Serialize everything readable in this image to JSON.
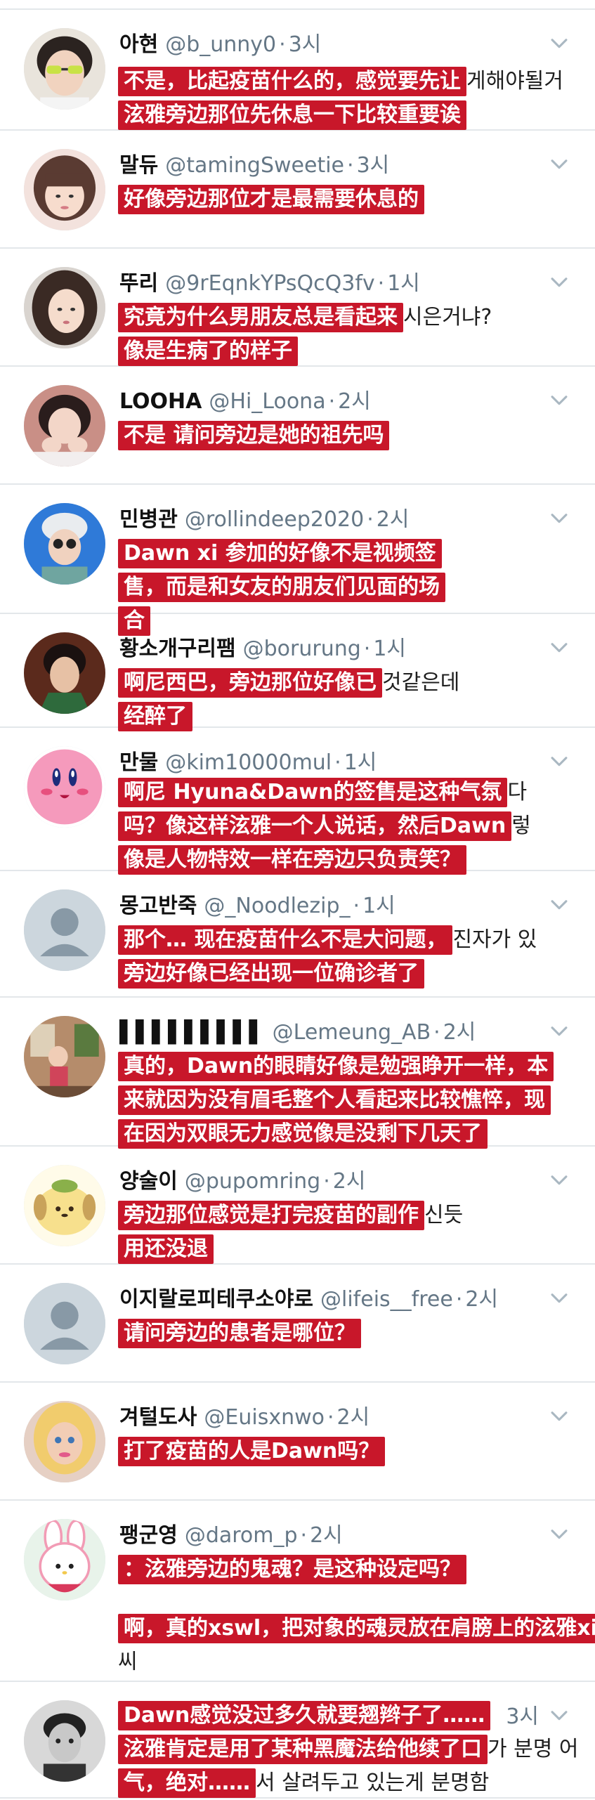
{
  "colors": {
    "overlay_red": "#c8172a",
    "divider": "#e3e7ea",
    "meta_gray": "#657786",
    "chevron_gray": "#aab8c2"
  },
  "tweets": [
    {
      "name": "아현",
      "handle": "@b_unny0",
      "time": "3시",
      "avatar": "girl-sunglasses",
      "lines": [
        {
          "hl": "不是，比起疫苗什么的，感觉要先让",
          "rest": "게해야될거"
        },
        {
          "hl": "泫雅旁边那位先休息一下比较重要诶",
          "rest": ""
        }
      ]
    },
    {
      "name": "말듀",
      "handle": "@tamingSweetie",
      "time": "3시",
      "avatar": "girl-bangs",
      "lines": [
        {
          "hl": "好像旁边那位才是最需要休息的",
          "rest": ""
        }
      ]
    },
    {
      "name": "뚜리",
      "handle": "@9rEqnkYPsQcQ3fv",
      "time": "1시",
      "avatar": "girl-long-hair",
      "lines": [
        {
          "hl": "究竟为什么男朋友总是看起来",
          "rest": "시은거냐?"
        },
        {
          "hl": "像是生病了的样子",
          "rest": ""
        }
      ]
    },
    {
      "name": "LOOHA",
      "handle": "@Hi_Loona",
      "time": "2시",
      "avatar": "girl-hands",
      "lines": [
        {
          "hl": "不是 请问旁边是她的祖先吗",
          "rest": ""
        }
      ]
    },
    {
      "name": "민병관",
      "handle": "@rollindeep2020",
      "time": "2시",
      "avatar": "person-hat",
      "lines": [
        {
          "hl": "Dawn xi 参加的好像不是视频签",
          "rest": ""
        },
        {
          "hl": "售，而是和女友的朋友们见面的场",
          "rest": ""
        },
        {
          "hl": "合",
          "rest": ""
        }
      ]
    },
    {
      "name": "황소개구리팸",
      "handle": "@borurung",
      "time": "1시",
      "avatar": "woman-traditional",
      "lines": [
        {
          "hl": "啊尼西巴，旁边那位好像已",
          "rest": "것같은데"
        },
        {
          "hl": "经醉了",
          "rest": ""
        }
      ]
    },
    {
      "name": "만물",
      "handle": "@kim10000mul",
      "time": "1시",
      "avatar": "kirby",
      "lines": [
        {
          "hl": "啊尼 Hyuna&Dawn的签售是这种气氛",
          "rest": "다"
        },
        {
          "hl": "吗？像这样泫雅一个人说话，然后Dawn",
          "rest": "렇"
        },
        {
          "hl": "像是人物特效一样在旁边只负责笑？",
          "rest": ""
        }
      ]
    },
    {
      "name": "몽고반죽",
      "handle": "@_Noodlezip_",
      "time": "1시",
      "avatar": "default",
      "lines": [
        {
          "hl": "那个… 现在疫苗什么不是大问题，",
          "rest": "진자가 있"
        },
        {
          "hl": "旁边好像已经出现一位确诊者了",
          "rest": ""
        }
      ]
    },
    {
      "name": "▌▌▌▌▌▌▌▌▌",
      "handle": "@Lemeung_AB",
      "time": "2시",
      "avatar": "child-room",
      "lines": [
        {
          "hl": "真的，Dawn的眼睛好像是勉强睁开一样，本",
          "rest": ""
        },
        {
          "hl": "来就因为没有眉毛整个人看起来比较憔悴，现",
          "rest": ""
        },
        {
          "hl": "在因为双眼无力感觉像是没剩下几天了",
          "rest": ""
        }
      ]
    },
    {
      "name": "양술이",
      "handle": "@pupomring",
      "time": "2시",
      "avatar": "pompompurin",
      "lines": [
        {
          "hl": "旁边那位感觉是打完疫苗的副作",
          "rest": "신듯"
        },
        {
          "hl": "用还没退",
          "rest": ""
        }
      ]
    },
    {
      "name": "이지랄로피테쿠소야로",
      "handle": "@lifeis__free",
      "time": "2시",
      "avatar": "default",
      "lines": [
        {
          "hl": "请问旁边的患者是哪位？",
          "rest": ""
        }
      ]
    },
    {
      "name": "겨털도사",
      "handle": "@Euisxnwo",
      "time": "2시",
      "avatar": "doll",
      "lines": [
        {
          "hl": "打了疫苗的人是Dawn吗？",
          "rest": ""
        }
      ]
    },
    {
      "name": "팽군영",
      "handle": "@darom_p",
      "time": "2시",
      "avatar": "melody",
      "lines": [
        {
          "hl": "：泫雅旁边的鬼魂？是这种设定吗？",
          "rest": ""
        },
        {
          "spacer": true
        },
        {
          "hl": "啊，真的xswl，把对象的魂灵放在肩膀上的泫雅xi",
          "rest": ""
        },
        {
          "hl": "",
          "rest": "씨"
        }
      ]
    },
    {
      "name": "",
      "handle": "",
      "time": "3시",
      "avatar": "bw-boy",
      "lines": [
        {
          "hl": "Dawn感觉没过多久就要翘辫子了……",
          "rest": ""
        },
        {
          "hl": "泫雅肯定是用了某种黑魔法给他续了口",
          "rest": "가 분명 어"
        },
        {
          "hl": "气，绝对……",
          "rest": "서 살려두고 있는게 분명함"
        }
      ]
    }
  ]
}
